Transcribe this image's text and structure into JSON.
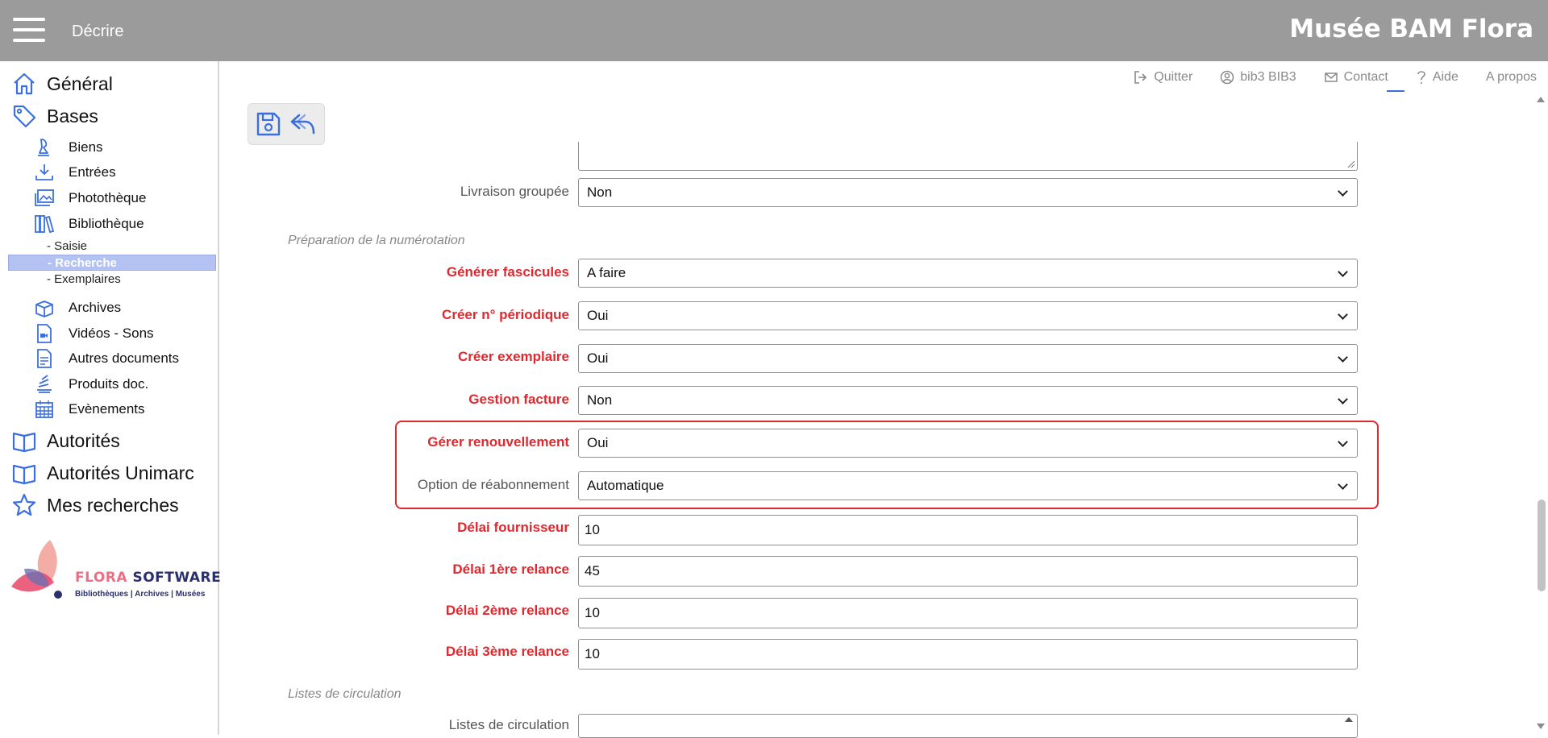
{
  "header": {
    "title": "Décrire",
    "brand": "Musée BAM Flora"
  },
  "topnav": {
    "quit": "Quitter",
    "user": "bib3 BIB3",
    "contact": "Contact",
    "help": "Aide",
    "about": "A propos"
  },
  "sidebar": {
    "general": "Général",
    "bases": "Bases",
    "biens": "Biens",
    "entrees": "Entrées",
    "phototheque": "Photothèque",
    "bibliotheque": "Bibliothèque",
    "saisie": "- Saisie",
    "recherche": "- Recherche",
    "exemplaires": "- Exemplaires",
    "archives": "Archives",
    "videos": "Vidéos - Sons",
    "autres": "Autres documents",
    "produits": "Produits doc.",
    "evenements": "Evènements",
    "autorites": "Autorités",
    "autorites_unimarc": "Autorités Unimarc",
    "mes_recherches": "Mes recherches"
  },
  "logo": {
    "word1": "FLORA",
    "word2": "SOFTWARE",
    "tagline": "Bibliothèques | Archives | Musées"
  },
  "form": {
    "livraison_label": "Livraison groupée",
    "livraison_value": "Non",
    "section_numerotation": "Préparation de la numérotation",
    "fascicules_label": "Générer fascicules",
    "fascicules_value": "A faire",
    "periodique_label": "Créer n° périodique",
    "periodique_value": "Oui",
    "exemplaire_label": "Créer exemplaire",
    "exemplaire_value": "Oui",
    "facture_label": "Gestion facture",
    "facture_value": "Non",
    "renouvellement_label": "Gérer renouvellement",
    "renouvellement_value": "Oui",
    "reabonnement_label": "Option de réabonnement",
    "reabonnement_value": "Automatique",
    "fournisseur_label": "Délai fournisseur",
    "fournisseur_value": "10",
    "relance1_label": "Délai 1ère relance",
    "relance1_value": "45",
    "relance2_label": "Délai 2ème relance",
    "relance2_value": "10",
    "relance3_label": "Délai 3ème relance",
    "relance3_value": "10",
    "section_circulation": "Listes de circulation",
    "circulation_label": "Listes de circulation"
  },
  "colors": {
    "header_bg": "#9b9b9b",
    "required_label": "#e0282e",
    "icon_blue": "#3b6fe0",
    "active_nav": "#b3c2f2"
  }
}
